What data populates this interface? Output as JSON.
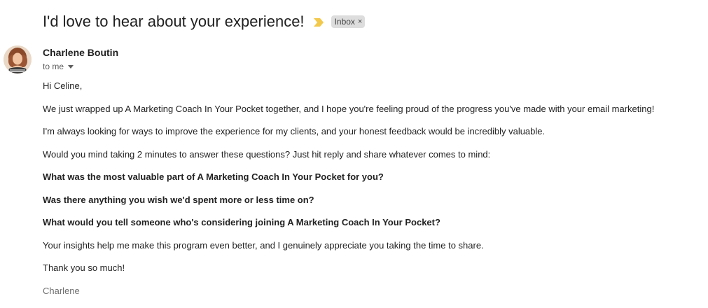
{
  "email": {
    "subject": "I'd love to hear about your experience!",
    "label": "Inbox",
    "label_remove": "×",
    "sender": "Charlene Boutin",
    "recipient": "to me",
    "colors": {
      "importance_marker": "#f2c94c",
      "label_bg": "#dddddd"
    },
    "body": {
      "greeting": "Hi Celine,",
      "p1": "We just wrapped up A Marketing Coach In Your Pocket together, and I hope you're feeling proud of the progress you've made with your email marketing!",
      "p2": "I'm always looking for ways to improve the experience for my clients, and your honest feedback would be incredibly valuable.",
      "p3": "Would you mind taking 2 minutes to answer these questions? Just hit reply and share whatever comes to mind:",
      "q1": "What was the most valuable part of A Marketing Coach In Your Pocket for you?",
      "q2": "Was there anything you wish we'd spent more or less time on?",
      "q3": "What would you tell someone who's considering joining A Marketing Coach In Your Pocket?",
      "p4": "Your insights help me make this program even better, and I genuinely appreciate you taking the time to share.",
      "closing": "Thank you so much!",
      "signature": "Charlene"
    }
  }
}
